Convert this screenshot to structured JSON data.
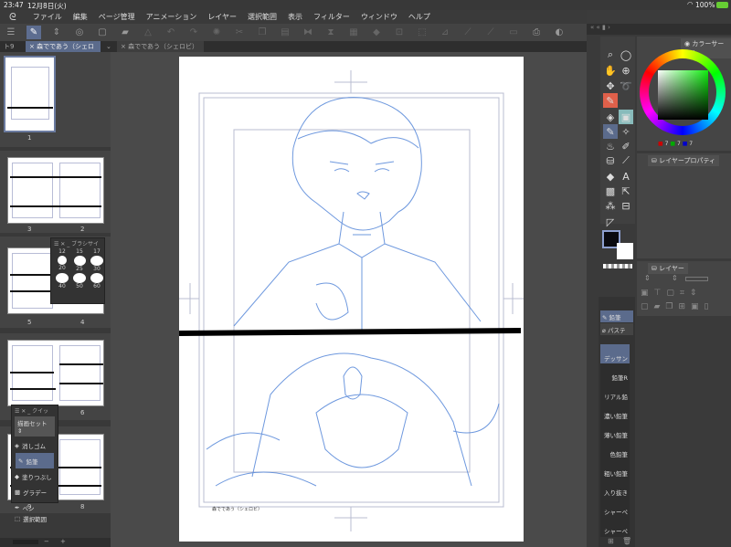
{
  "status": {
    "time": "23:47",
    "date": "12月8日(火)",
    "battery": "100%"
  },
  "menu": [
    "ファイル",
    "編集",
    "ページ管理",
    "アニメーション",
    "レイヤー",
    "選択範囲",
    "表示",
    "フィルター",
    "ウィンドウ",
    "ヘルプ"
  ],
  "tabs": {
    "left_partial": "ト9",
    "doc_tab": "森でであう（シェロビ）",
    "page_tab": "森でであう（シェロビ） 1/9"
  },
  "pages": {
    "labels": [
      "1",
      "3",
      "2",
      "5",
      "4",
      "6",
      "9",
      "8"
    ]
  },
  "brush_size": {
    "title": "ブラシサイ",
    "sizes": [
      "12",
      "15",
      "17",
      "20",
      "25",
      "30",
      "40",
      "50",
      "60"
    ]
  },
  "quick_access": {
    "title": "クイッ",
    "set": "描画セット",
    "items": [
      "消しゴム",
      "鉛筆",
      "塗りつぶし",
      "グラデー",
      "ペン",
      "選択範囲"
    ],
    "selected": "鉛筆"
  },
  "canvas": {
    "caption": "森でであう（シェロビ）"
  },
  "color": {
    "tab": "カラーサークル",
    "r": "7",
    "g": "7",
    "b": "7",
    "main": "#0a0a10",
    "sub": "#ffffff"
  },
  "layer_property": {
    "tab": "レイヤープロパティ"
  },
  "layer": {
    "tab": "レイヤー"
  },
  "subtool": {
    "tabs": [
      "鉛筆",
      "パステ"
    ],
    "brushes": [
      "デッサン",
      "鉛筆R",
      "リアル鉛",
      "濃い鉛筆",
      "薄い鉛筆",
      "色鉛筆",
      "粗い鉛筆",
      "入り抜き",
      "シャーペ",
      "シャーペ"
    ],
    "selected": "デッサン"
  }
}
